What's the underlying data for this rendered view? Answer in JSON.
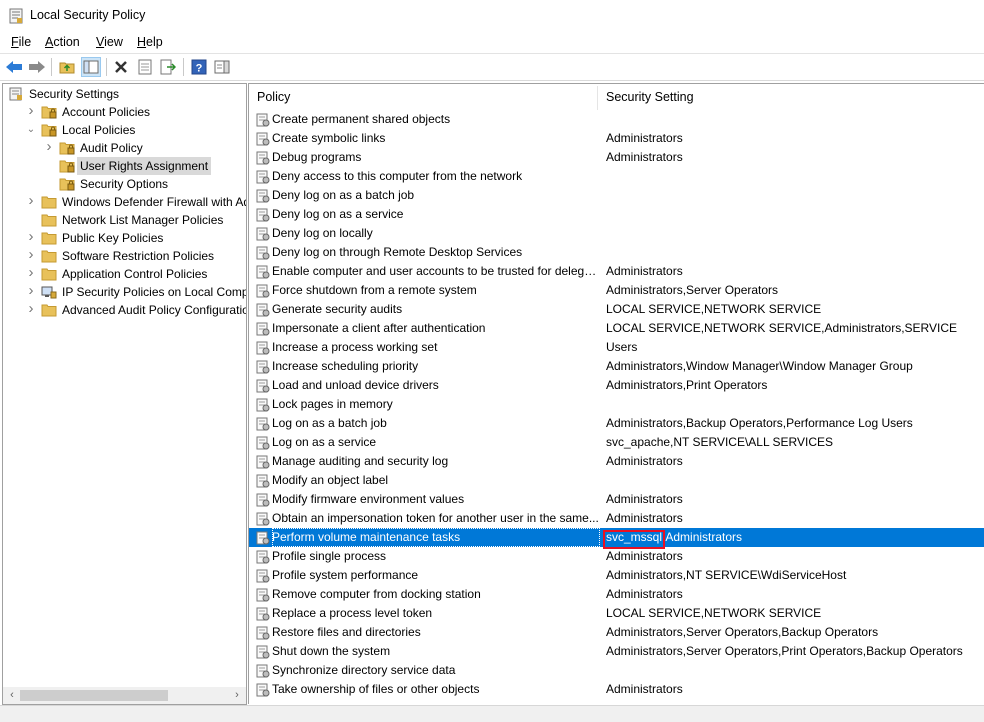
{
  "window": {
    "title": "Local Security Policy"
  },
  "menu": [
    {
      "label": "File",
      "accel": "F",
      "rest": "ile"
    },
    {
      "label": "Action",
      "accel": "A",
      "rest": "ction"
    },
    {
      "label": "View",
      "accel": "V",
      "rest": "iew"
    },
    {
      "label": "Help",
      "accel": "H",
      "rest": "elp"
    }
  ],
  "toolbar": {
    "buttons": [
      "back-icon",
      "forward-icon",
      "up-folder-icon",
      "show-hide-tree-icon",
      "delete-icon",
      "properties-icon",
      "export-list-icon",
      "help-icon",
      "show-action-pane-icon"
    ]
  },
  "tree": {
    "items": [
      {
        "label": "Security Settings",
        "level": 0,
        "expander": "",
        "icon": "security-settings-icon"
      },
      {
        "label": "Account Policies",
        "level": 1,
        "expander": ">",
        "icon": "folder-lock-icon"
      },
      {
        "label": "Local Policies",
        "level": 1,
        "expander": "v",
        "icon": "folder-lock-icon"
      },
      {
        "label": "Audit Policy",
        "level": 2,
        "expander": ">",
        "icon": "folder-lock-icon"
      },
      {
        "label": "User Rights Assignment",
        "level": 2,
        "expander": "",
        "icon": "folder-lock-icon",
        "selected": true
      },
      {
        "label": "Security Options",
        "level": 2,
        "expander": "",
        "icon": "folder-lock-icon"
      },
      {
        "label": "Windows Defender Firewall with Adva",
        "level": 1,
        "expander": ">",
        "icon": "folder-icon"
      },
      {
        "label": "Network List Manager Policies",
        "level": 1,
        "expander": "",
        "icon": "folder-icon"
      },
      {
        "label": "Public Key Policies",
        "level": 1,
        "expander": ">",
        "icon": "folder-icon"
      },
      {
        "label": "Software Restriction Policies",
        "level": 1,
        "expander": ">",
        "icon": "folder-icon"
      },
      {
        "label": "Application Control Policies",
        "level": 1,
        "expander": ">",
        "icon": "folder-icon"
      },
      {
        "label": "IP Security Policies on Local Compute",
        "level": 1,
        "expander": ">",
        "icon": "ip-security-icon"
      },
      {
        "label": "Advanced Audit Policy Configuration",
        "level": 1,
        "expander": ">",
        "icon": "folder-icon"
      }
    ]
  },
  "list": {
    "columns": {
      "policy": "Policy",
      "setting": "Security Setting"
    },
    "rows": [
      {
        "policy": "Create permanent shared objects",
        "setting": ""
      },
      {
        "policy": "Create symbolic links",
        "setting": "Administrators"
      },
      {
        "policy": "Debug programs",
        "setting": "Administrators"
      },
      {
        "policy": "Deny access to this computer from the network",
        "setting": ""
      },
      {
        "policy": "Deny log on as a batch job",
        "setting": ""
      },
      {
        "policy": "Deny log on as a service",
        "setting": ""
      },
      {
        "policy": "Deny log on locally",
        "setting": ""
      },
      {
        "policy": "Deny log on through Remote Desktop Services",
        "setting": ""
      },
      {
        "policy": "Enable computer and user accounts to be trusted for delega...",
        "setting": "Administrators"
      },
      {
        "policy": "Force shutdown from a remote system",
        "setting": "Administrators,Server Operators"
      },
      {
        "policy": "Generate security audits",
        "setting": "LOCAL SERVICE,NETWORK SERVICE"
      },
      {
        "policy": "Impersonate a client after authentication",
        "setting": "LOCAL SERVICE,NETWORK SERVICE,Administrators,SERVICE"
      },
      {
        "policy": "Increase a process working set",
        "setting": "Users"
      },
      {
        "policy": "Increase scheduling priority",
        "setting": "Administrators,Window Manager\\Window Manager Group"
      },
      {
        "policy": "Load and unload device drivers",
        "setting": "Administrators,Print Operators"
      },
      {
        "policy": "Lock pages in memory",
        "setting": ""
      },
      {
        "policy": "Log on as a batch job",
        "setting": "Administrators,Backup Operators,Performance Log Users"
      },
      {
        "policy": "Log on as a service",
        "setting": "svc_apache,NT SERVICE\\ALL SERVICES"
      },
      {
        "policy": "Manage auditing and security log",
        "setting": "Administrators"
      },
      {
        "policy": "Modify an object label",
        "setting": ""
      },
      {
        "policy": "Modify firmware environment values",
        "setting": "Administrators"
      },
      {
        "policy": "Obtain an impersonation token for another user in the same...",
        "setting": "Administrators"
      },
      {
        "policy": "Perform volume maintenance tasks",
        "setting": "",
        "setting_highlight": "svc_mssql",
        "setting_rest": ",Administrators",
        "selected": true
      },
      {
        "policy": "Profile single process",
        "setting": "Administrators"
      },
      {
        "policy": "Profile system performance",
        "setting": "Administrators,NT SERVICE\\WdiServiceHost"
      },
      {
        "policy": "Remove computer from docking station",
        "setting": "Administrators"
      },
      {
        "policy": "Replace a process level token",
        "setting": "LOCAL SERVICE,NETWORK SERVICE"
      },
      {
        "policy": "Restore files and directories",
        "setting": "Administrators,Server Operators,Backup Operators"
      },
      {
        "policy": "Shut down the system",
        "setting": "Administrators,Server Operators,Print Operators,Backup Operators"
      },
      {
        "policy": "Synchronize directory service data",
        "setting": ""
      },
      {
        "policy": "Take ownership of files or other objects",
        "setting": "Administrators"
      }
    ]
  },
  "colors": {
    "selection": "#0078d7",
    "highlight_box": "#e81123",
    "folder": "#e8c15a"
  }
}
